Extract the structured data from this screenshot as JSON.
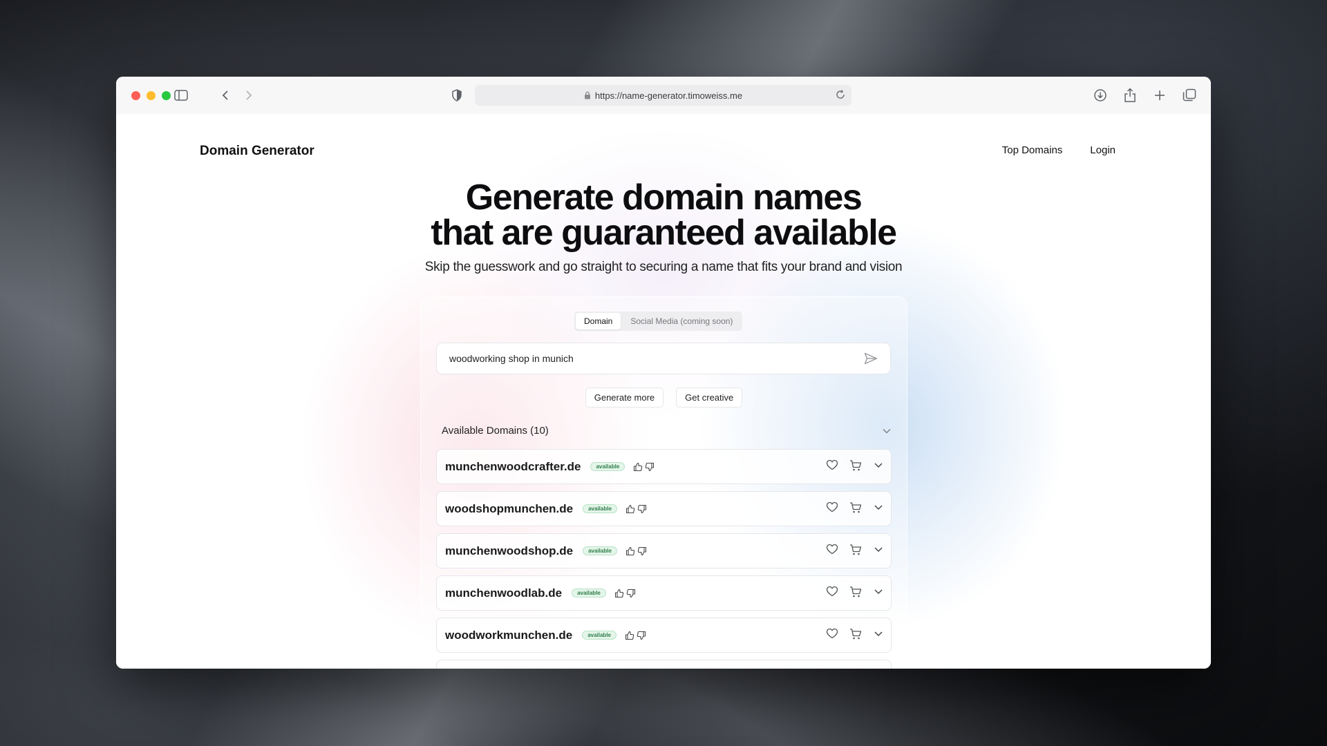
{
  "browser": {
    "url": "https://name-generator.timoweiss.me"
  },
  "site": {
    "brand": "Domain Generator",
    "nav": [
      "Top Domains",
      "Login"
    ]
  },
  "hero": {
    "title_line1": "Generate domain names",
    "title_line2": "that are guaranteed available",
    "subtitle": "Skip the guesswork and go straight to securing a name that fits your brand and vision"
  },
  "tabs": [
    {
      "label": "Domain",
      "active": true
    },
    {
      "label": "Social Media (coming soon)",
      "active": false
    }
  ],
  "search": {
    "value": "woodworking shop in munich"
  },
  "actions": {
    "generate_more": "Generate more",
    "get_creative": "Get creative"
  },
  "results": {
    "heading": "Available Domains (10)",
    "items": [
      {
        "name": "munchenwoodcrafter.de",
        "status": "available"
      },
      {
        "name": "woodshopmunchen.de",
        "status": "available"
      },
      {
        "name": "munchenwoodshop.de",
        "status": "available"
      },
      {
        "name": "munchenwoodlab.de",
        "status": "available"
      },
      {
        "name": "woodworkmunchen.de",
        "status": "available"
      }
    ]
  },
  "icons": {
    "sidebar": "sidebar-icon",
    "back": "chevron-left-icon",
    "forward": "chevron-right-icon",
    "shield": "shield-icon",
    "lock": "lock-icon",
    "reload": "reload-icon",
    "download": "download-icon",
    "share": "share-icon",
    "new_tab": "plus-icon",
    "tabs": "tabs-overview-icon",
    "send": "send-icon",
    "thumbs_up": "thumbs-up-icon",
    "thumbs_down": "thumbs-down-icon",
    "heart": "heart-icon",
    "cart": "cart-icon",
    "expand": "chevron-down-icon"
  },
  "colors": {
    "available_badge": "#2e7d4a",
    "traffic_red": "#ff5f57",
    "traffic_yellow": "#febc2e",
    "traffic_green": "#28c840"
  }
}
